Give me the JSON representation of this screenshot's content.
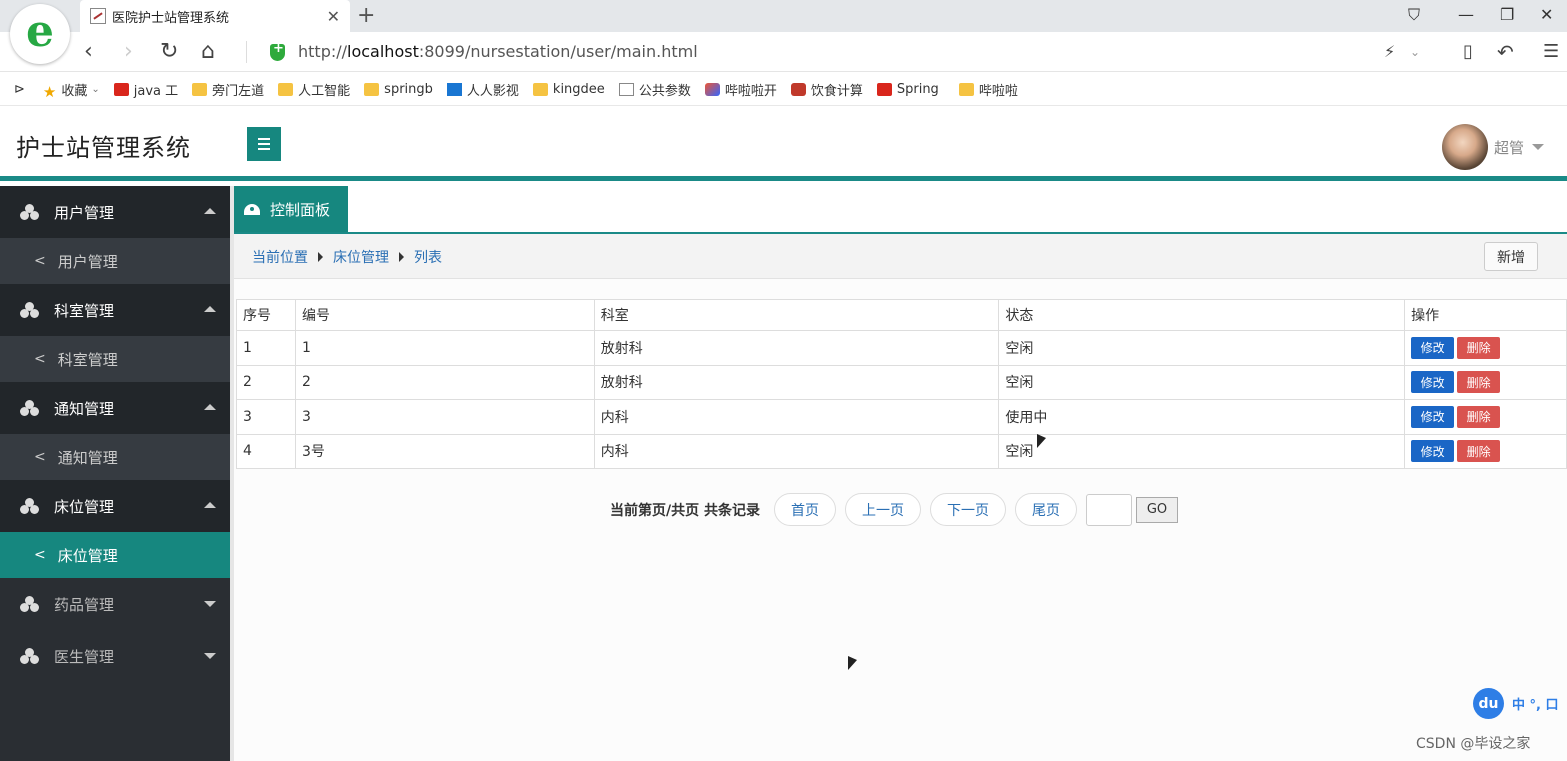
{
  "browser": {
    "tab_title": "医院护士站管理系统",
    "url_prefix": "http://",
    "url_host": "localhost",
    "url_rest": ":8099/nursestation/user/main.html",
    "bookmarks": [
      "收藏",
      "java 工",
      "旁门左道",
      "人工智能",
      "springb",
      "人人影视",
      "kingdee",
      "公共参数",
      "哔啦啦开",
      "饮食计算",
      "Spring",
      "哔啦啦"
    ]
  },
  "header": {
    "app_title": "护士站管理系统",
    "user_name": "超管"
  },
  "sidebar": {
    "groups": [
      {
        "label": "用户管理",
        "item": "用户管理"
      },
      {
        "label": "科室管理",
        "item": "科室管理"
      },
      {
        "label": "通知管理",
        "item": "通知管理"
      },
      {
        "label": "床位管理",
        "item": "床位管理"
      },
      {
        "label": "药品管理"
      },
      {
        "label": "医生管理"
      }
    ]
  },
  "main": {
    "tab_label": "控制面板",
    "breadcrumb": [
      "当前位置",
      "床位管理",
      "列表"
    ],
    "add_label": "新增",
    "columns": [
      "序号",
      "编号",
      "科室",
      "状态",
      "操作"
    ],
    "rows": [
      {
        "no": "1",
        "code": "1",
        "dept": "放射科",
        "status": "空闲"
      },
      {
        "no": "2",
        "code": "2",
        "dept": "放射科",
        "status": "空闲"
      },
      {
        "no": "3",
        "code": "3",
        "dept": "内科",
        "status": "使用中"
      },
      {
        "no": "4",
        "code": "3号",
        "dept": "内科",
        "status": "空闲"
      }
    ],
    "edit_label": "修改",
    "delete_label": "删除",
    "pager": {
      "info": "当前第页/共页  共条记录",
      "first": "首页",
      "prev": "上一页",
      "next": "下一页",
      "last": "尾页",
      "go": "GO"
    }
  },
  "ime": {
    "badge": "du",
    "text": "中 °, 口"
  },
  "watermark": "CSDN @毕设之家",
  "colors": {
    "accent": "#16877f",
    "edit": "#1a66c6",
    "delete": "#d9534f",
    "link": "#2a6fb4"
  }
}
